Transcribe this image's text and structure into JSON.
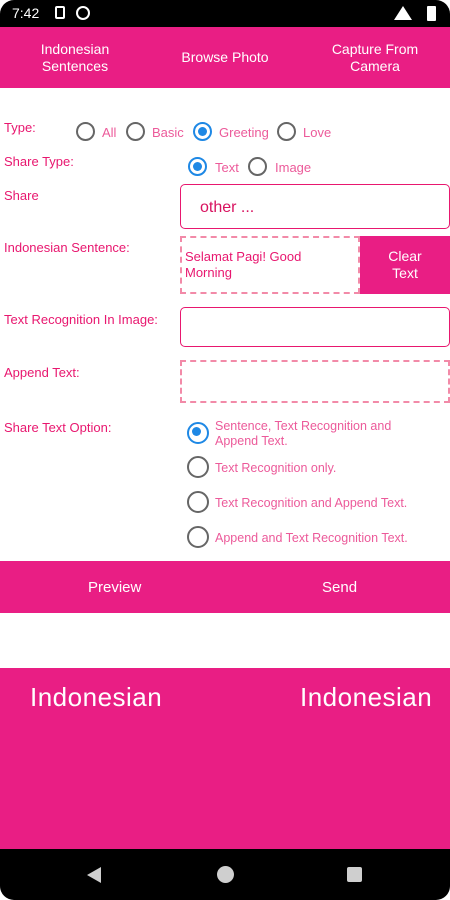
{
  "status_bar": {
    "time": "7:42"
  },
  "top_bar": {
    "indonesian_sentences": "Indonesian Sentences",
    "browse_photo": "Browse Photo",
    "capture_from_camera": "Capture From Camera"
  },
  "type": {
    "label": "Type:",
    "options": [
      "All",
      "Basic",
      "Greeting",
      "Love"
    ],
    "selected": "Greeting"
  },
  "share_type": {
    "label": "Share Type:",
    "options": [
      "Text",
      "Image"
    ],
    "selected": "Text"
  },
  "share": {
    "label": "Share",
    "value": "other ..."
  },
  "indonesian_sentence": {
    "label": "Indonesian Sentence:",
    "value": "Selamat Pagi! Good Morning",
    "clear_button": "Clear Text"
  },
  "text_recognition": {
    "label": "Text Recognition In Image:",
    "value": ""
  },
  "append_text": {
    "label": "Append Text:",
    "value": ""
  },
  "share_text_option": {
    "label": "Share Text Option:",
    "options": [
      "Sentence, Text Recognition and Append Text.",
      "Text Recognition only.",
      "Text Recognition and Append Text.",
      "Append and Text Recognition Text."
    ],
    "selected_index": 0
  },
  "bottom_bar": {
    "preview": "Preview",
    "send": "Send"
  },
  "banner": {
    "left": "Indonesian",
    "right": "Indonesian"
  },
  "colors": {
    "accent": "#e91e84",
    "text_accent": "#e8176f",
    "radio_selected": "#1e88e5"
  }
}
